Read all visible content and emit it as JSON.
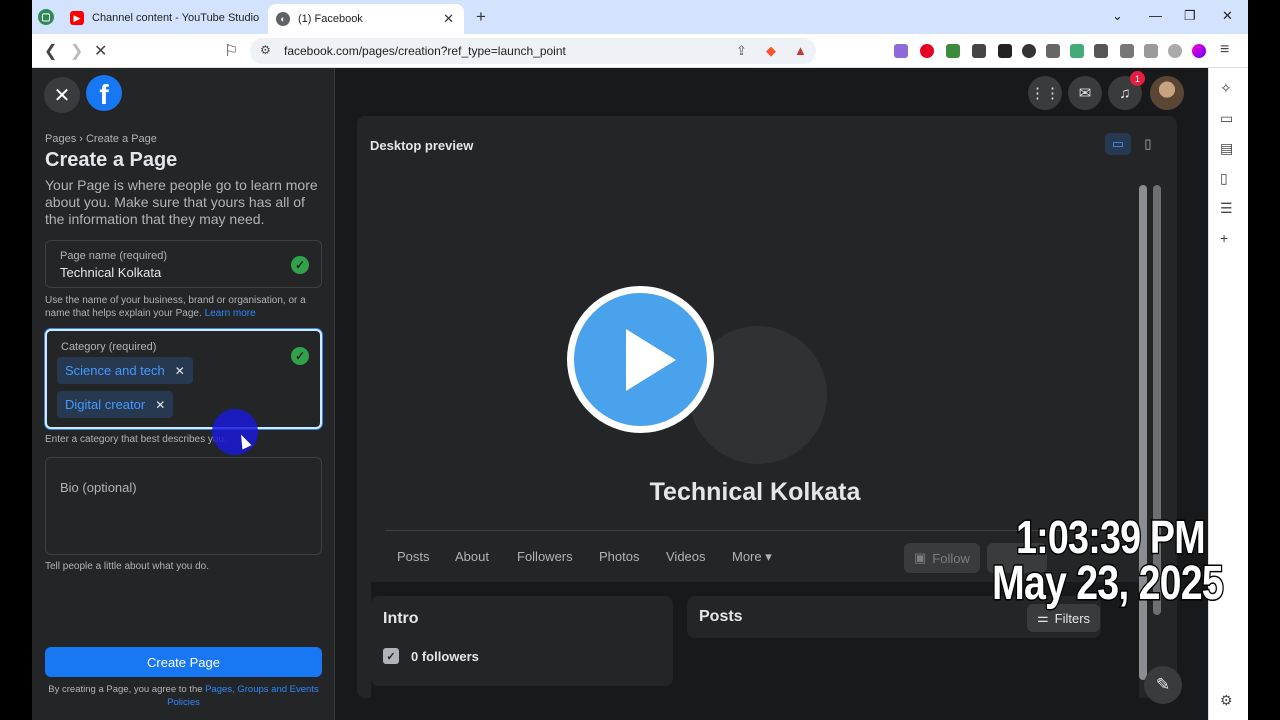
{
  "tabs": [
    {
      "title": "Channel content - YouTube Studio",
      "icon": "youtube-icon"
    },
    {
      "title": "(1) Facebook",
      "icon": "globe-icon"
    }
  ],
  "address": {
    "url": "facebook.com/pages/creation?ref_type=launch_point"
  },
  "left_panel": {
    "breadcrumb": "Pages › Create a Page",
    "title": "Create a Page",
    "intro": "Your Page is where people go to learn more about you. Make sure that yours has all of the information that they may need.",
    "page_name": {
      "label": "Page name (required)",
      "value": "Technical Kolkata",
      "hint": "Use the name of your business, brand or organisation, or a name that helps explain your Page.",
      "learn_more": "Learn more"
    },
    "category": {
      "label": "Category (required)",
      "chips": [
        "Science and tech",
        "Digital creator"
      ],
      "hint": "Enter a category that best describes you."
    },
    "bio": {
      "placeholder": "Bio (optional)",
      "hint": "Tell people a little about what you do."
    },
    "create_button": "Create Page",
    "terms_prefix": "By creating a Page, you agree to the",
    "terms_link": "Pages, Groups and Events Policies"
  },
  "nav": {
    "notification_count": "1"
  },
  "preview": {
    "label": "Desktop preview",
    "page_name": "Technical Kolkata",
    "tabs": [
      "Posts",
      "About",
      "Followers",
      "Photos",
      "Videos",
      "More ▾"
    ],
    "follow_button": "Follow",
    "intro_title": "Intro",
    "followers_text": "0 followers",
    "posts_title": "Posts",
    "filters_button": "Filters"
  },
  "overlay": {
    "time": "1:03:39 PM",
    "date": "May 23, 2025"
  },
  "colors": {
    "accent": "#1877f2",
    "chip_text": "#4599ff",
    "success": "#31a24c"
  }
}
